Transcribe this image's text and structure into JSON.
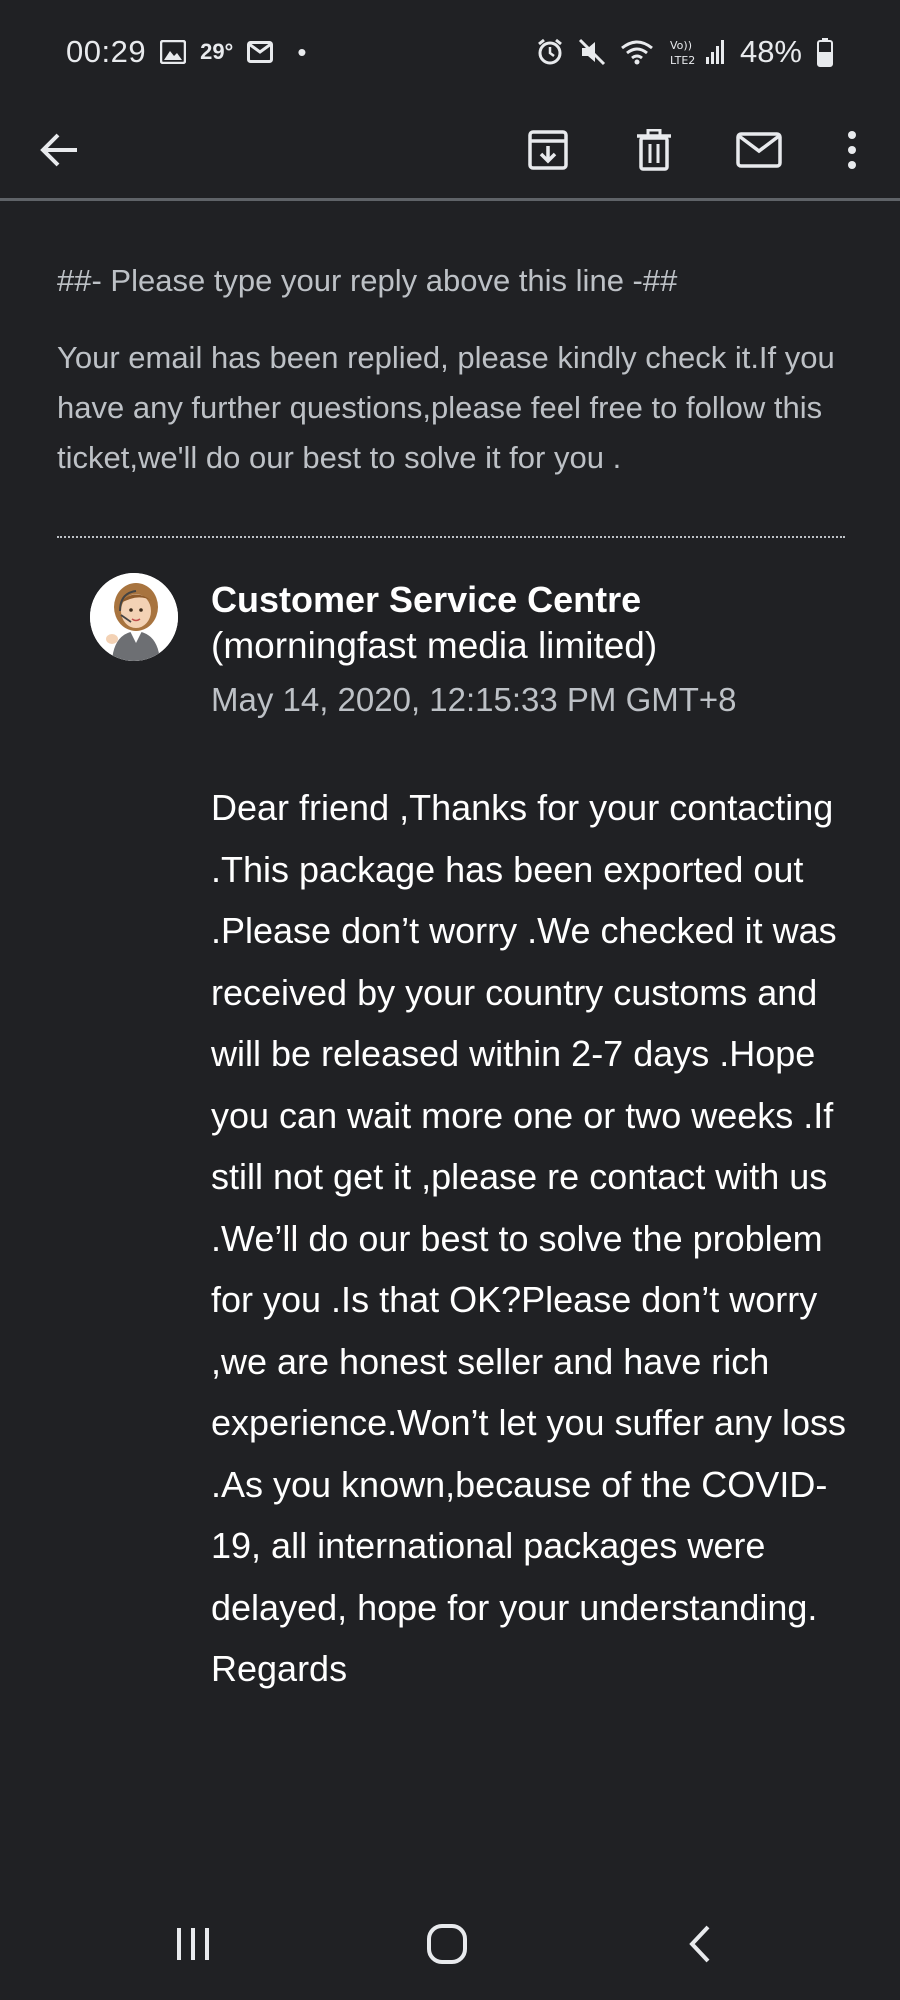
{
  "status_bar": {
    "time": "00:29",
    "temperature": "29°",
    "dot": "•",
    "battery": "48%",
    "icons": [
      "gallery-icon",
      "mail-notification-icon",
      "alarm-icon",
      "mute-icon",
      "wifi-icon",
      "volte-signal-icon",
      "battery-icon"
    ]
  },
  "toolbar": {
    "icons": [
      "back-arrow-icon",
      "archive-icon",
      "delete-icon",
      "mark-unread-icon",
      "more-options-icon"
    ]
  },
  "email": {
    "reply_line": "##- Please type your reply above this line -##",
    "reply_notice": "Your email has been replied, please kindly check it.If you have any further questions,please feel free to follow this ticket,we'll do our best to solve it for you .",
    "sender_name": "Customer Service Centre",
    "sender_org": "(morningfast media limited)",
    "sent_date": "May 14, 2020, 12:15:33 PM GMT+8",
    "body": "Dear friend ,Thanks for your contacting .This package has been exported out .Please don’t worry .We checked it was received by your country customs and will be released within 2-7 days .Hope you can wait more one or two weeks .If still not get it ,please re contact with us .We’ll do our best to solve the problem for you .Is that OK?Please don’t worry ,we are honest seller and have rich experience.Won’t let you suffer any loss .As you known,because of the COVID-19, all international packages were delayed, hope for your understanding. Regards"
  },
  "nav_bar": {
    "icons": [
      "recent-apps-icon",
      "home-icon",
      "nav-back-icon"
    ]
  },
  "colors": {
    "background": "#202124",
    "primary_text": "#ffffff",
    "secondary_text": "#bdc1c6",
    "divider": "#5f6368"
  }
}
